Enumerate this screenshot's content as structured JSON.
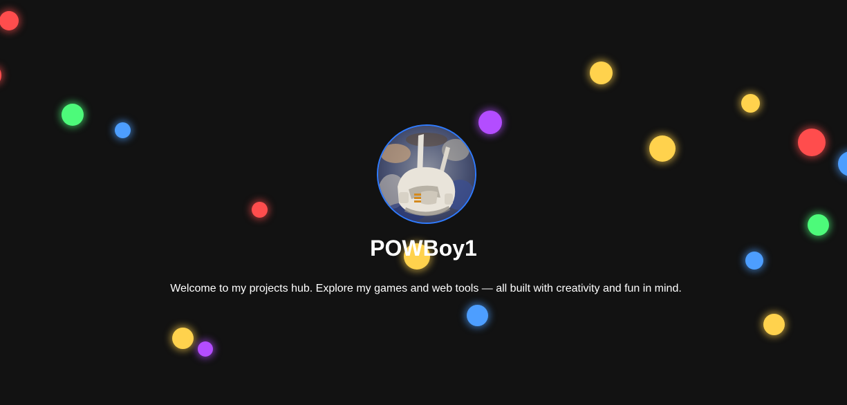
{
  "profile": {
    "username": "POWBoy1",
    "tagline": "Welcome to my projects hub. Explore my games and web tools — all built with creativity and fun in mind."
  },
  "theme": {
    "background": "#121212",
    "avatar_border": "#2f7bff",
    "text": "#ffffff"
  },
  "background_orb_colors": [
    "red",
    "green",
    "blue",
    "yellow",
    "purple"
  ]
}
